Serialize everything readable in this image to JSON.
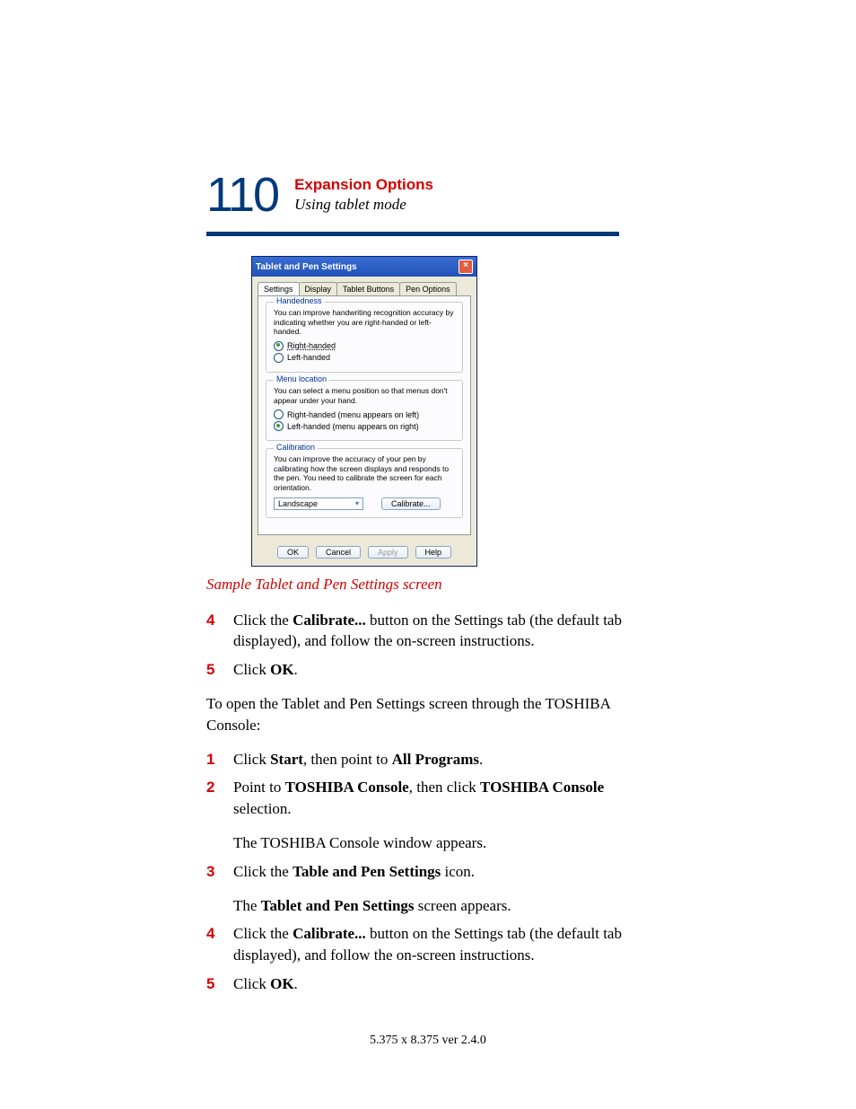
{
  "page_number": "110",
  "chapter_title": "Expansion Options",
  "section_title": "Using tablet mode",
  "dialog": {
    "title": "Tablet and Pen Settings",
    "tabs": [
      "Settings",
      "Display",
      "Tablet Buttons",
      "Pen Options"
    ],
    "handedness": {
      "legend": "Handedness",
      "desc": "You can improve handwriting recognition accuracy by indicating whether you are right-handed or left-handed.",
      "opt1": "Right-handed",
      "opt2": "Left-handed"
    },
    "menu": {
      "legend": "Menu location",
      "desc": "You can select a menu position so that menus don't appear under your hand.",
      "opt1": "Right-handed (menu appears on left)",
      "opt2": "Left-handed (menu appears on right)"
    },
    "calib": {
      "legend": "Calibration",
      "desc": "You can improve the accuracy of your pen by calibrating how the screen displays and responds to the pen. You need to calibrate the screen for each orientation.",
      "combo": "Landscape",
      "button": "Calibrate..."
    },
    "buttons": {
      "ok": "OK",
      "cancel": "Cancel",
      "apply": "Apply",
      "help": "Help"
    }
  },
  "caption": "Sample Tablet and Pen Settings screen",
  "steps_a": {
    "n4": "4",
    "t4a": "Click the ",
    "t4b": "Calibrate...",
    "t4c": " button on the Settings tab (the default tab displayed), and follow the on-screen instructions.",
    "n5": "5",
    "t5a": "Click ",
    "t5b": "OK",
    "t5c": "."
  },
  "intro2": "To open the Tablet and Pen Settings screen through the TOSHIBA Console:",
  "steps_b": {
    "n1": "1",
    "t1a": "Click ",
    "t1b": "Start",
    "t1c": ", then point to ",
    "t1d": "All Programs",
    "t1e": ".",
    "n2": "2",
    "t2a": "Point to ",
    "t2b": "TOSHIBA Console",
    "t2c": ", then click ",
    "t2d": "TOSHIBA Console",
    "t2e": " selection.",
    "t2f": "The TOSHIBA Console window appears.",
    "n3": "3",
    "t3a": "Click the ",
    "t3b": "Table and Pen Settings",
    "t3c": " icon.",
    "t3f": "The ",
    "t3g": "Tablet and Pen Settings",
    "t3h": " screen appears.",
    "n4": "4",
    "t4a": "Click the ",
    "t4b": "Calibrate...",
    "t4c": " button on the Settings tab (the default tab displayed), and follow the on-screen instructions.",
    "n5": "5",
    "t5a": "Click ",
    "t5b": "OK",
    "t5c": "."
  },
  "footer": "5.375 x 8.375 ver 2.4.0"
}
